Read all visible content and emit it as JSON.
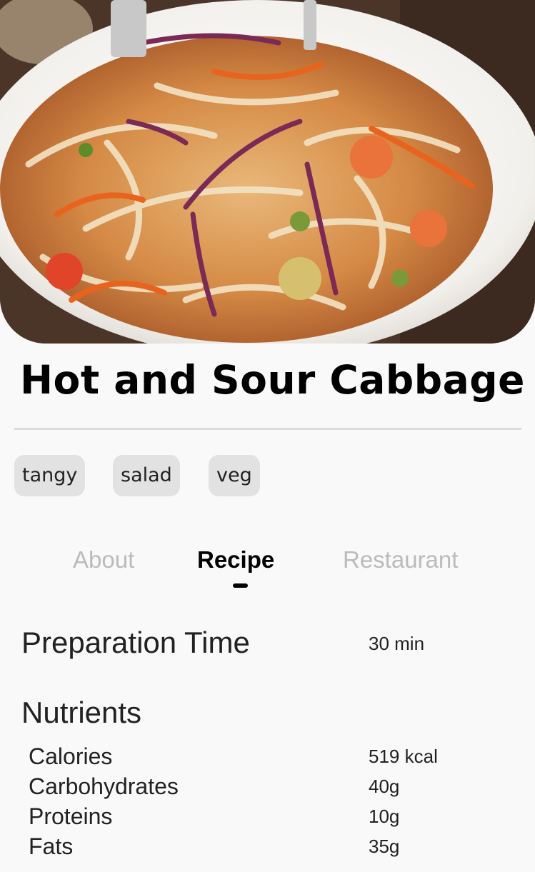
{
  "recipe": {
    "title": "Hot and Sour Cabbage",
    "tags": [
      "tangy",
      "salad",
      "veg"
    ]
  },
  "tabs": [
    {
      "label": "About",
      "active": false
    },
    {
      "label": "Recipe",
      "active": true
    },
    {
      "label": "Restaurant",
      "active": false
    }
  ],
  "preparation": {
    "label": "Preparation Time",
    "value": "30 min"
  },
  "nutrients": {
    "heading": "Nutrients",
    "items": [
      {
        "label": "Calories",
        "value": "519 kcal"
      },
      {
        "label": "Carbohydrates",
        "value": "40g"
      },
      {
        "label": "Proteins",
        "value": "10g"
      },
      {
        "label": "Fats",
        "value": "35g"
      }
    ]
  },
  "colors": {
    "background": "#f9f9f9",
    "tag_background": "#e2e2e2",
    "tab_inactive": "#bbbbbb",
    "tab_active": "#000000",
    "divider": "#dcdcdc"
  }
}
